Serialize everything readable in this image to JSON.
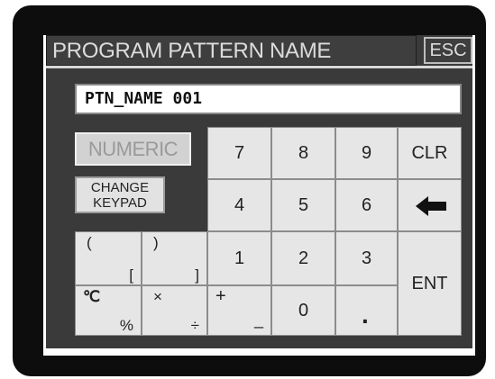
{
  "header": {
    "title": "PROGRAM PATTERN NAME",
    "esc_label": "ESC"
  },
  "input": {
    "value": "PTN_NAME 001"
  },
  "mode": {
    "numeric_label": "NUMERIC",
    "change_label_line1": "CHANGE",
    "change_label_line2": "KEYPAD"
  },
  "keys": {
    "k7": "7",
    "k8": "8",
    "k9": "9",
    "clr": "CLR",
    "k4": "4",
    "k5": "5",
    "k6": "6",
    "k1": "1",
    "k2": "2",
    "k3": "3",
    "ent": "ENT",
    "k0": "0",
    "dot": "."
  },
  "symbols": {
    "paren_open": "(",
    "bracket_open": "[",
    "paren_close": ")",
    "bracket_close": "]",
    "degc": "℃",
    "percent": "%",
    "times": "×",
    "divide": "÷",
    "plus": "+",
    "minus": "_"
  },
  "icons": {
    "backspace": "left-arrow-icon"
  }
}
